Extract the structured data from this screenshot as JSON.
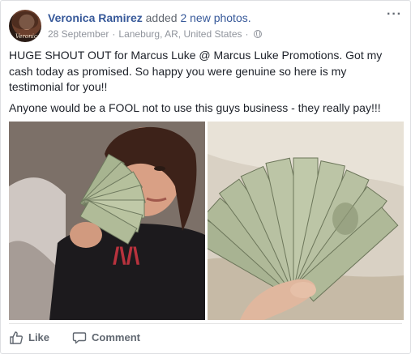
{
  "post": {
    "author": "Veronica Ramirez",
    "action_prefix": "added",
    "action_link": "2 new photos.",
    "avatar_watermark": "Veronica",
    "date": "28 September",
    "location": "Laneburg, AR, United States",
    "separator": "·",
    "privacy_icon": "globe-icon",
    "more_icon": "more-options-icon",
    "text_lines": [
      "HUGE SHOUT OUT for Marcus Luke @ Marcus Luke Promotions. Got my cash today as promised. So happy you were genuine so here is my testimonial for you!!",
      "Anyone would be a FOOL not to use this guys business - they really pay!!!"
    ],
    "photos": [
      {
        "name": "woman-holding-cash-photo"
      },
      {
        "name": "hand-holding-fanned-bills-photo"
      }
    ]
  },
  "actions": {
    "like_label": "Like",
    "comment_label": "Comment"
  },
  "colors": {
    "link": "#365899",
    "meta": "#90949c",
    "text": "#1d2129",
    "action": "#606770"
  }
}
